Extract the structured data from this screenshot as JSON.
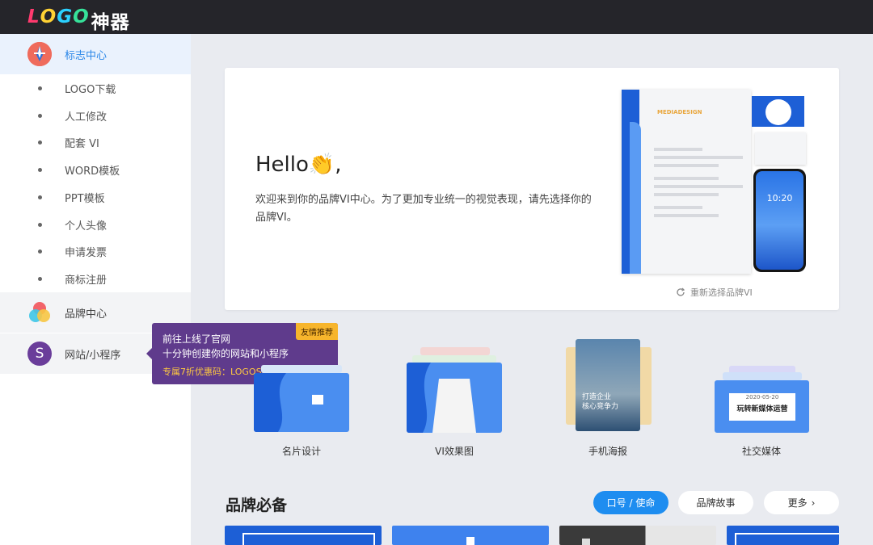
{
  "brand": {
    "logo_latin": [
      "L",
      "O",
      "G",
      "O"
    ],
    "logo_cn": "神器"
  },
  "sidebar": {
    "logo_center": "标志中心",
    "sub_items": [
      "LOGO下载",
      "人工修改",
      "配套 VI",
      "WORD模板",
      "PPT模板",
      "个人头像",
      "申请发票",
      "商标注册"
    ],
    "brand_center": "品牌中心",
    "site": {
      "label": "网站/小程序",
      "avatar_letter": "S"
    }
  },
  "tooltip": {
    "tag": "友情推荐",
    "line1": "前往上线了官网",
    "line2": "十分钟创建你的网站和小程序",
    "line3": "专属7折优惠码：LOGOSC"
  },
  "hero": {
    "hello": "Hello👏,",
    "intro": "欢迎来到你的品牌VI中心。为了更加专业统一的视觉表现，请先选择你的品牌VI。",
    "reselect": "重新选择品牌VI",
    "mock_brand": "MEDIADESIGN",
    "mock_time": "10:20"
  },
  "categories": [
    {
      "label": "名片设计"
    },
    {
      "label": "VI效果图"
    },
    {
      "label": "手机海报",
      "poster_text": "打造企业\n核心竞争力"
    },
    {
      "label": "社交媒体",
      "date": "2020-05-20",
      "headline": "玩转新媒体运营"
    }
  ],
  "brand_section": {
    "title": "品牌必备",
    "tabs": [
      "口号 / 使命",
      "品牌故事"
    ],
    "more": "更多",
    "active_tab": 0
  },
  "colors": {
    "accent": "#1e8df0",
    "topbar": "#25252a",
    "tooltip": "#5f3b8c",
    "tag": "#f7b52c"
  }
}
